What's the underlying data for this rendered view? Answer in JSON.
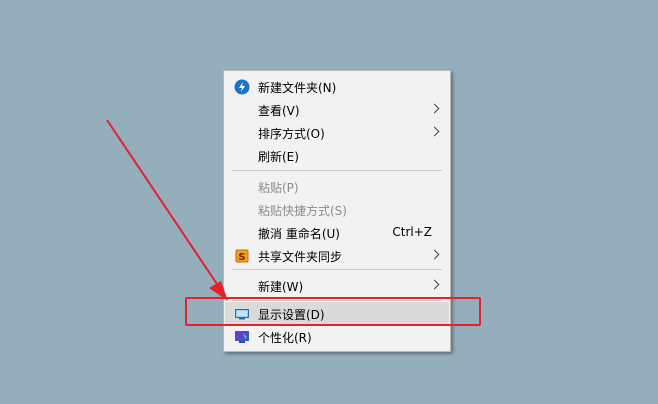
{
  "context_menu": {
    "items": [
      {
        "label": "新建文件夹(N)",
        "icon": "new-folder-icon"
      },
      {
        "label": "查看(V)",
        "submenu": true
      },
      {
        "label": "排序方式(O)",
        "submenu": true
      },
      {
        "label": "刷新(E)"
      },
      {
        "label": "粘贴(P)",
        "disabled": true
      },
      {
        "label": "粘贴快捷方式(S)",
        "disabled": true
      },
      {
        "label": "撤消 重命名(U)",
        "shortcut": "Ctrl+Z"
      },
      {
        "label": "共享文件夹同步",
        "icon": "sync-s-icon",
        "submenu": true
      },
      {
        "label": "新建(W)",
        "submenu": true
      },
      {
        "label": "显示设置(D)",
        "icon": "display-icon",
        "highlighted": true
      },
      {
        "label": "个性化(R)",
        "icon": "personalize-icon"
      }
    ]
  },
  "annotation": {
    "color": "#e8202a"
  },
  "colors": {
    "desktop": "#95aebc",
    "menu_bg": "#f2f2f2",
    "highlight": "#dadada"
  }
}
